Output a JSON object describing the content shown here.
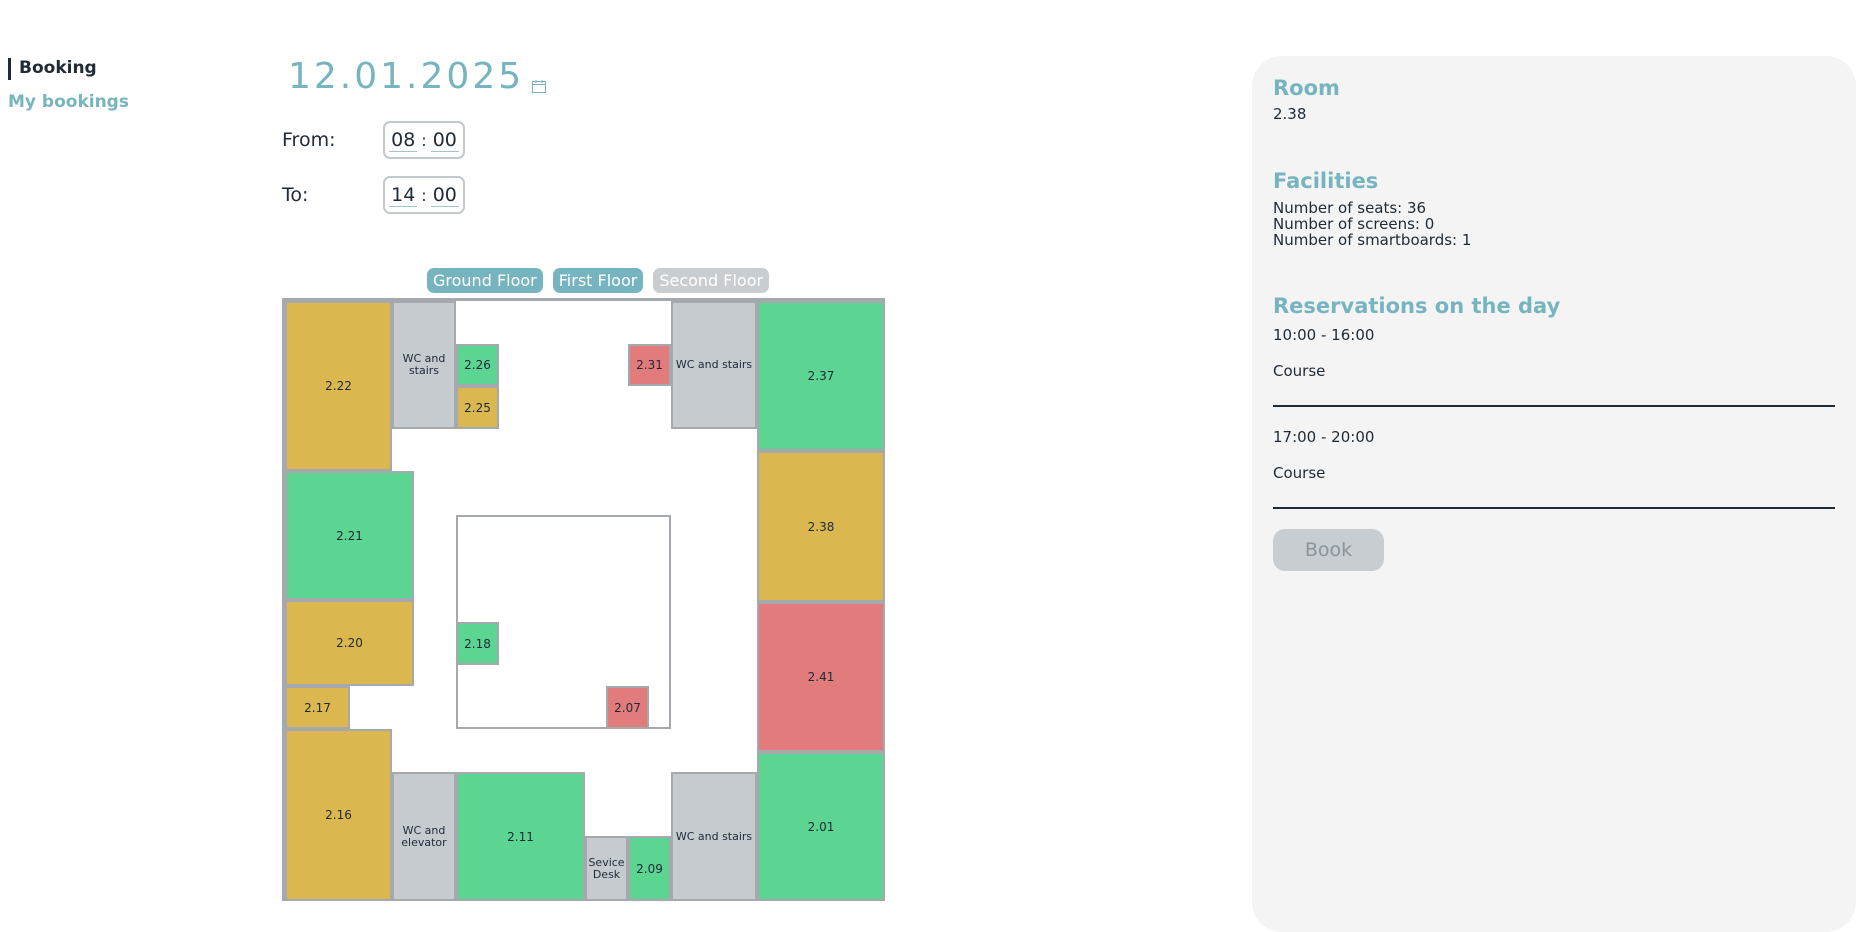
{
  "nav": {
    "active": "Booking",
    "link": "My bookings"
  },
  "date": "12.01.2025",
  "time": {
    "from_label": "From:",
    "from_hh": "08",
    "from_mm": "00",
    "to_label": "To:",
    "to_hh": "14",
    "to_mm": "00",
    "separator": ":"
  },
  "floors": [
    "Ground Floor",
    "First Floor",
    "Second Floor"
  ],
  "rooms": {
    "r222": "2.22",
    "wc_stairs_tl": "WC and stairs",
    "r226": "2.26",
    "r225": "2.25",
    "r231": "2.31",
    "wc_stairs_tr": "WC and stairs",
    "r237": "2.37",
    "r221": "2.21",
    "r238": "2.38",
    "r220": "2.20",
    "r218": "2.18",
    "r241": "2.41",
    "r217": "2.17",
    "r207": "2.07",
    "r216": "2.16",
    "wc_elevator": "WC and elevator",
    "r211": "2.11",
    "service_desk": "Sevice Desk",
    "r209": "2.09",
    "wc_stairs_br": "WC and stairs",
    "r201": "2.01"
  },
  "panel": {
    "room_heading": "Room",
    "room_value": "2.38",
    "facilities_heading": "Facilities",
    "seats": "Number of seats: 36",
    "screens": "Number of screens: 0",
    "smartboards": "Number of smartboards: 1",
    "reservations_heading": "Reservations on the day",
    "reservations": [
      {
        "time": "10:00 - 16:00",
        "title": "Course"
      },
      {
        "time": "17:00 - 20:00",
        "title": "Course"
      }
    ],
    "book_label": "Book"
  },
  "colors": {
    "accent": "#76b4c0",
    "available": "#5cd492",
    "partially_booked": "#dab74f",
    "booked": "#e27c7c",
    "facility": "#c6cbd0"
  },
  "icons": {
    "date_picker": "calendar-icon"
  }
}
